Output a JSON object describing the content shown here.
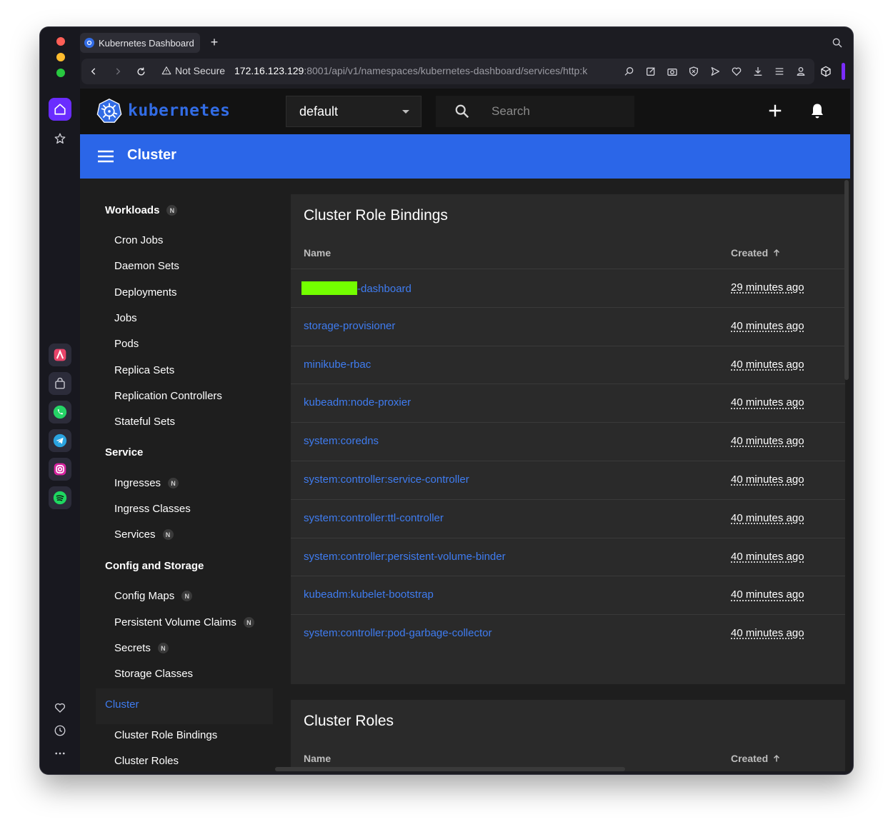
{
  "browser": {
    "tab_title": "Kubernetes Dashboard",
    "new_tab": "+",
    "security_label": "Not Secure",
    "url_host": "172.16.123.129",
    "url_rest": ":8001/api/v1/namespaces/kubernetes-dashboard/services/http:k"
  },
  "header": {
    "logo_text": "kubernetes",
    "namespace": "default",
    "search_placeholder": "Search"
  },
  "toolbar": {
    "title": "Cluster"
  },
  "sidebar": {
    "workloads": {
      "label": "Workloads",
      "badge": "N",
      "items": [
        "Cron Jobs",
        "Daemon Sets",
        "Deployments",
        "Jobs",
        "Pods",
        "Replica Sets",
        "Replication Controllers",
        "Stateful Sets"
      ]
    },
    "service": {
      "label": "Service",
      "items": [
        {
          "label": "Ingresses",
          "badge": "N"
        },
        {
          "label": "Ingress Classes"
        },
        {
          "label": "Services",
          "badge": "N"
        }
      ]
    },
    "config": {
      "label": "Config and Storage",
      "items": [
        {
          "label": "Config Maps",
          "badge": "N"
        },
        {
          "label": "Persistent Volume Claims",
          "badge": "N"
        },
        {
          "label": "Secrets",
          "badge": "N"
        },
        {
          "label": "Storage Classes"
        }
      ]
    },
    "cluster": {
      "label": "Cluster",
      "items": [
        "Cluster Role Bindings",
        "Cluster Roles"
      ]
    }
  },
  "cluster_role_bindings": {
    "title": "Cluster Role Bindings",
    "col_name": "Name",
    "col_created": "Created",
    "rows": [
      {
        "name": "-dashboard",
        "created": "29 minutes ago",
        "redacted_prefix": true
      },
      {
        "name": "storage-provisioner",
        "created": "40 minutes ago"
      },
      {
        "name": "minikube-rbac",
        "created": "40 minutes ago"
      },
      {
        "name": "kubeadm:node-proxier",
        "created": "40 minutes ago"
      },
      {
        "name": "system:coredns",
        "created": "40 minutes ago"
      },
      {
        "name": "system:controller:service-controller",
        "created": "40 minutes ago"
      },
      {
        "name": "system:controller:ttl-controller",
        "created": "40 minutes ago"
      },
      {
        "name": "system:controller:persistent-volume-binder",
        "created": "40 minutes ago"
      },
      {
        "name": "kubeadm:kubelet-bootstrap",
        "created": "40 minutes ago"
      },
      {
        "name": "system:controller:pod-garbage-collector",
        "created": "40 minutes ago"
      }
    ]
  },
  "cluster_roles": {
    "title": "Cluster Roles",
    "col_name": "Name",
    "col_created": "Created"
  },
  "colors": {
    "accent": "#2b66e8",
    "link": "#3f7cf0",
    "redaction": "#73ff00"
  }
}
